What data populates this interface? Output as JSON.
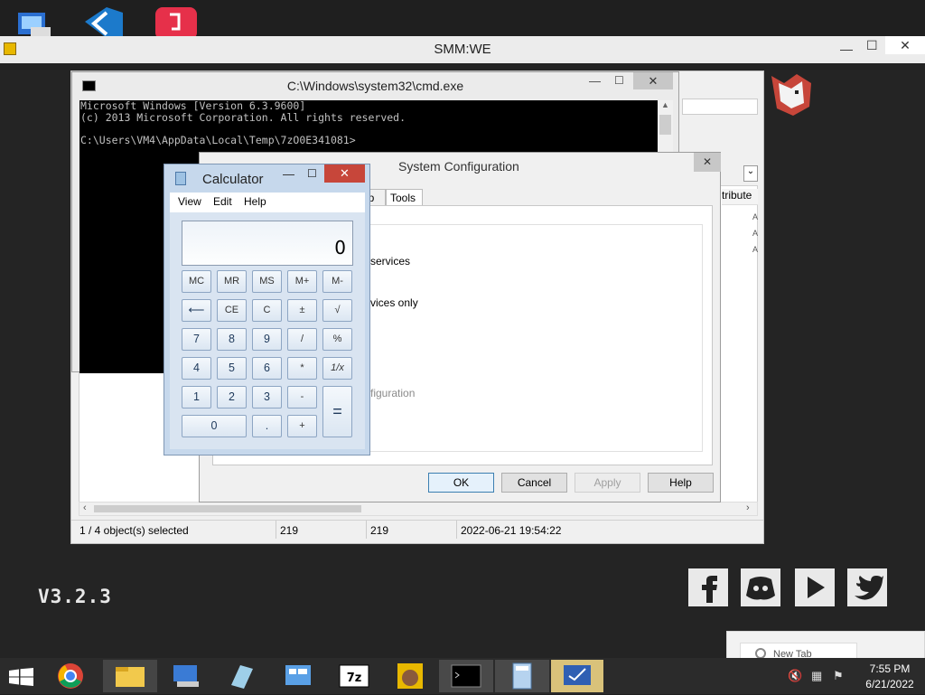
{
  "smm": {
    "title": "SMM:WE",
    "version": "V3.2.3",
    "minimize": "—",
    "maximize": "☐",
    "close": "✕"
  },
  "cmd": {
    "title": "C:\\Windows\\system32\\cmd.exe",
    "lines": [
      "Microsoft Windows [Version 6.3.9600]",
      "(c) 2013 Microsoft Corporation. All rights reserved.",
      "",
      "C:\\Users\\VM4\\AppData\\Local\\Temp\\7zO0E341081>"
    ]
  },
  "sevenzip": {
    "status": {
      "selection": "1 / 4 object(s) selected",
      "size1": "219",
      "size2": "219",
      "datetime": "2022-06-21 19:54:22"
    },
    "col_header_partial": "tribute",
    "side_marks": [
      "A",
      "A",
      "A"
    ]
  },
  "sysconf": {
    "title": "System Configuration",
    "tabs": [
      "up",
      "Tools"
    ],
    "fragments": [
      "services",
      "vices only",
      "figuration"
    ],
    "buttons": {
      "ok": "OK",
      "cancel": "Cancel",
      "apply": "Apply",
      "help": "Help"
    }
  },
  "calculator": {
    "title": "Calculator",
    "menu": [
      "View",
      "Edit",
      "Help"
    ],
    "display": "0",
    "keys": {
      "mc": "MC",
      "mr": "MR",
      "ms": "MS",
      "mplus": "M+",
      "mminus": "M-",
      "back": "⟵",
      "ce": "CE",
      "c": "C",
      "plusminus": "±",
      "sqrt": "√",
      "n7": "7",
      "n8": "8",
      "n9": "9",
      "div": "/",
      "pct": "%",
      "n4": "4",
      "n5": "5",
      "n6": "6",
      "mul": "*",
      "recip": "1/x",
      "n1": "1",
      "n2": "2",
      "n3": "3",
      "sub": "-",
      "eq": "=",
      "n0": "0",
      "dot": ".",
      "add": "+"
    }
  },
  "chrome_popup": {
    "tab_label": "New Tab"
  },
  "tray": {
    "time": "7:55 PM",
    "date": "6/21/2022"
  },
  "colors": {
    "desktop_bg": "#242424",
    "taskbar": "#2b2b2b",
    "close_red": "#c7463a",
    "ok_blue": "#3c7fb1"
  }
}
